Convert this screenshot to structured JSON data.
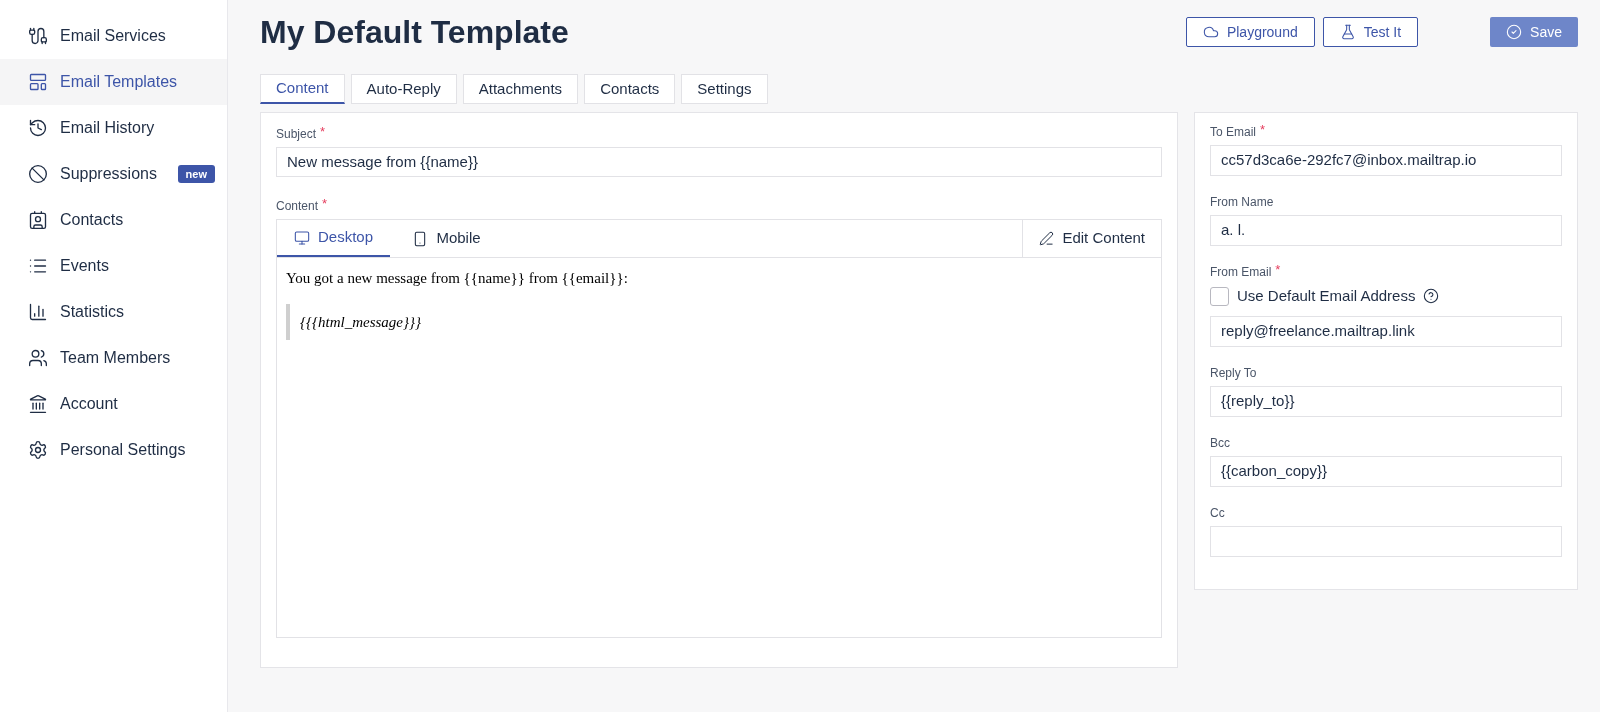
{
  "sidebar": {
    "items": [
      {
        "label": "Email Services",
        "selected": false
      },
      {
        "label": "Email Templates",
        "selected": true
      },
      {
        "label": "Email History",
        "selected": false
      },
      {
        "label": "Suppressions",
        "selected": false,
        "badge": "new"
      },
      {
        "label": "Contacts",
        "selected": false
      },
      {
        "label": "Events",
        "selected": false
      },
      {
        "label": "Statistics",
        "selected": false
      },
      {
        "label": "Team Members",
        "selected": false
      },
      {
        "label": "Account",
        "selected": false
      },
      {
        "label": "Personal Settings",
        "selected": false
      }
    ]
  },
  "title": "My Default Template",
  "header_buttons": [
    {
      "label": "Playground",
      "kind": "outline"
    },
    {
      "label": "Test It",
      "kind": "outline"
    },
    {
      "label": "Save",
      "kind": "primary"
    }
  ],
  "tabs": [
    {
      "label": "Content",
      "selected": true
    },
    {
      "label": "Auto-Reply",
      "selected": false
    },
    {
      "label": "Attachments",
      "selected": false
    },
    {
      "label": "Contacts",
      "selected": false
    },
    {
      "label": "Settings",
      "selected": false
    }
  ],
  "subject": {
    "label": "Subject",
    "required_mark": "*",
    "value": "New message from {{name}}"
  },
  "content": {
    "label": "Content",
    "required_mark": "*",
    "view_tabs": [
      {
        "label": "Desktop",
        "selected": true
      },
      {
        "label": "Mobile",
        "selected": false
      }
    ],
    "edit_button": "Edit Content",
    "body_line": "You got a new message from {{name}} from {{email}}:",
    "blockquote": "{{{html_message}}}"
  },
  "side_fields": [
    {
      "kind": "text",
      "label": "To Email",
      "required_mark": "*",
      "value": "cc57d3ca6e-292fc7@inbox.mailtrap.io"
    },
    {
      "kind": "text",
      "label": "From Name",
      "value": "a. l."
    },
    {
      "kind": "checkbox_text",
      "label": "From Email",
      "required_mark": "*",
      "checkbox_label": "Use Default Email Address",
      "checked": false,
      "value": "reply@freelance.mailtrap.link"
    },
    {
      "kind": "text",
      "label": "Reply To",
      "value": "{{reply_to}}"
    },
    {
      "kind": "text",
      "label": "Bcc",
      "value": "{{carbon_copy}}"
    },
    {
      "kind": "text",
      "label": "Cc"
    }
  ]
}
